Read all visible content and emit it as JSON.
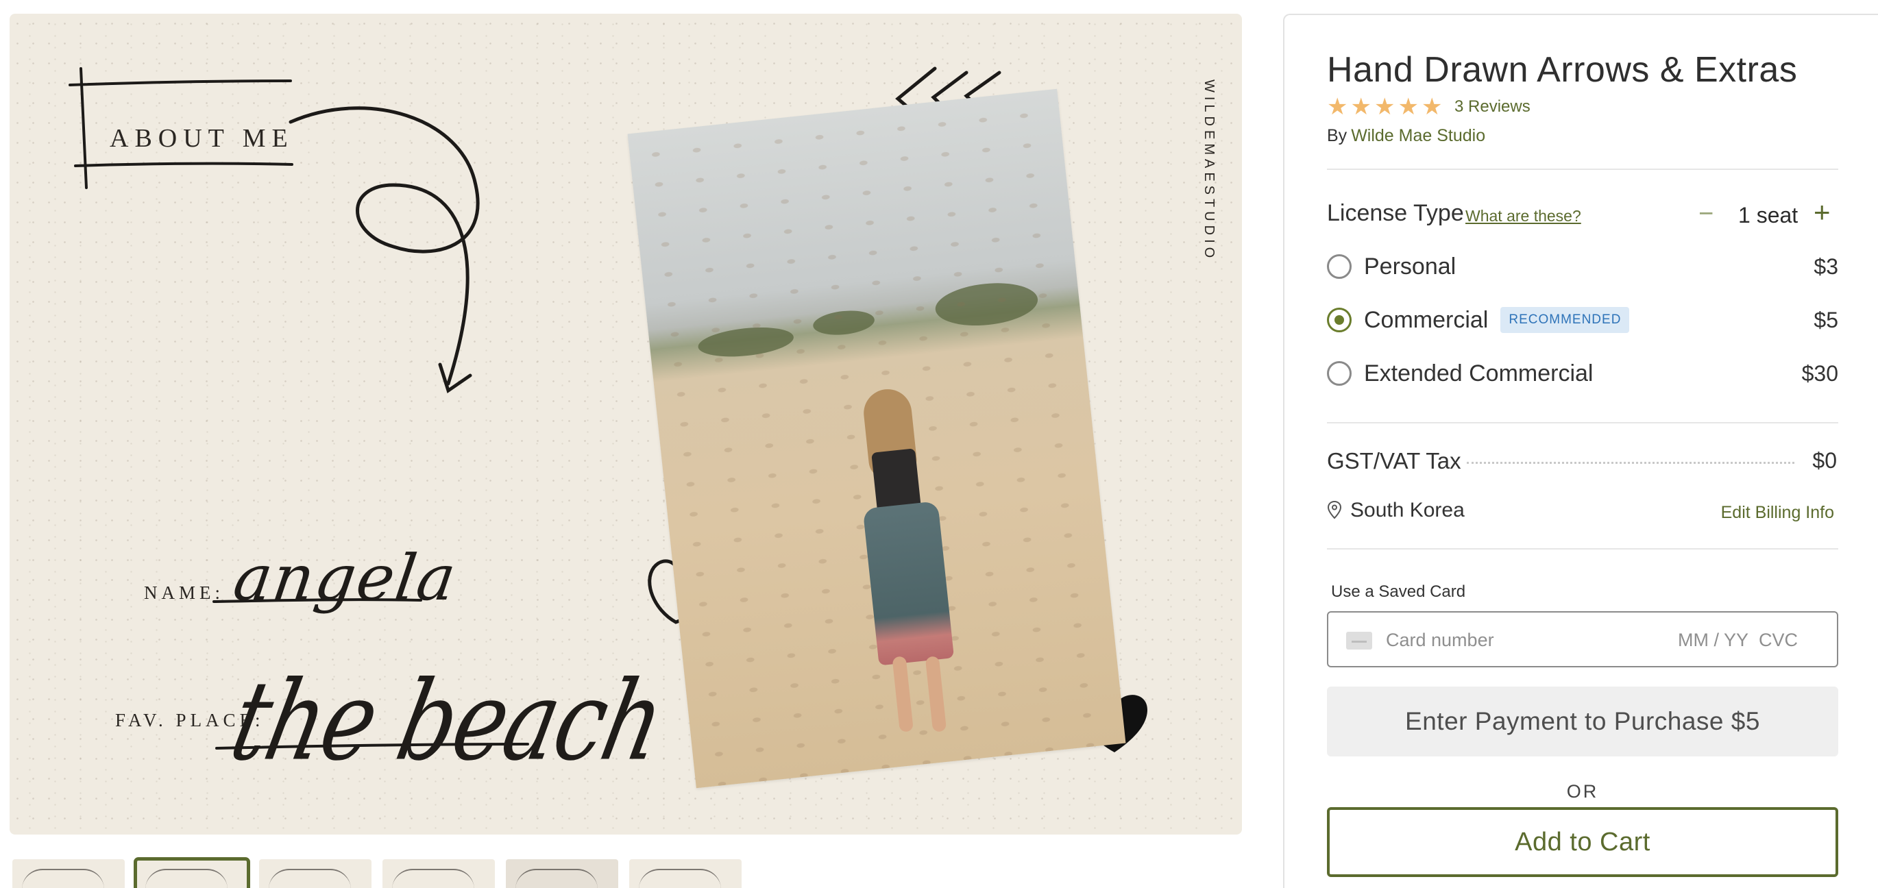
{
  "preview": {
    "about_me": "ABOUT ME",
    "name_label": "NAME:",
    "name_value": "angela",
    "place_label": "FAV. PLACE:",
    "place_value": "the beach",
    "brand_vertical": "WILDEMAESTUDIO"
  },
  "thumbnails": {
    "count": 6,
    "active_index": 1
  },
  "product": {
    "title": "Hand Drawn Arrows & Extras",
    "rating_stars": 5,
    "reviews": "3 Reviews",
    "by_label": "By",
    "author": "Wilde Mae Studio"
  },
  "license": {
    "title": "License Type",
    "help_link": "What are these?",
    "seat_minus": "−",
    "seat_count": "1 seat",
    "seat_plus": "+",
    "options": [
      {
        "label": "Personal",
        "price": "$3",
        "selected": false,
        "badge": ""
      },
      {
        "label": "Commercial",
        "price": "$5",
        "selected": true,
        "badge": "RECOMMENDED"
      },
      {
        "label": "Extended Commercial",
        "price": "$30",
        "selected": false,
        "badge": ""
      }
    ]
  },
  "tax": {
    "label": "GST/VAT Tax",
    "value": "$0",
    "location": "South Korea",
    "edit_link": "Edit Billing Info"
  },
  "payment": {
    "saved_card_label": "Use a Saved Card",
    "card_placeholder": "Card number",
    "exp_placeholder": "MM / YY",
    "cvc_placeholder": "CVC",
    "pay_button": "Enter Payment to Purchase $5",
    "or_text": "OR",
    "cart_button": "Add to Cart"
  },
  "colors": {
    "accent": "#5b6b2e",
    "star": "#f2b86b",
    "badge_bg": "#dbe9f6",
    "badge_text": "#2e73b8",
    "preview_bg": "#f0ebe1"
  }
}
